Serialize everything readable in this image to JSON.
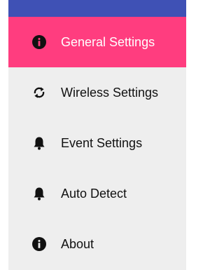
{
  "theme": {
    "header_color": "#3f51b5",
    "active_color": "#ff3d7f",
    "drawer_bg": "#eeeeee"
  },
  "menu": {
    "items": [
      {
        "label": "General Settings",
        "icon": "info-icon",
        "active": true
      },
      {
        "label": "Wireless Settings",
        "icon": "sync-icon",
        "active": false
      },
      {
        "label": "Event Settings",
        "icon": "bell-icon",
        "active": false
      },
      {
        "label": "Auto Detect",
        "icon": "bell-icon",
        "active": false
      },
      {
        "label": "About",
        "icon": "info-icon",
        "active": false
      }
    ]
  }
}
